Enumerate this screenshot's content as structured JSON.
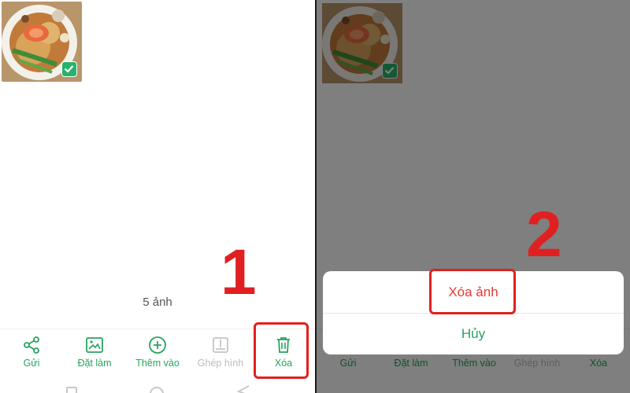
{
  "panel1": {
    "photo_count": "5 ảnh",
    "toolbar": [
      "Gửi",
      "Đặt làm",
      "Thêm vào",
      "Ghép hình",
      "Xóa"
    ],
    "step_number": "1"
  },
  "panel2": {
    "toolbar": [
      "Gửi",
      "Đặt làm",
      "Thêm vào",
      "Ghép hình",
      "Xóa"
    ],
    "sheet": {
      "delete_label": "Xóa ảnh",
      "cancel_label": "Hủy"
    },
    "step_number": "2"
  },
  "colors": {
    "accent_green": "#27a35f",
    "delete_red": "#e53935",
    "highlight_red": "#e02020"
  },
  "icons": [
    "share-icon",
    "set-as-icon",
    "add-to-icon",
    "collage-icon",
    "trash-icon",
    "check-icon"
  ]
}
